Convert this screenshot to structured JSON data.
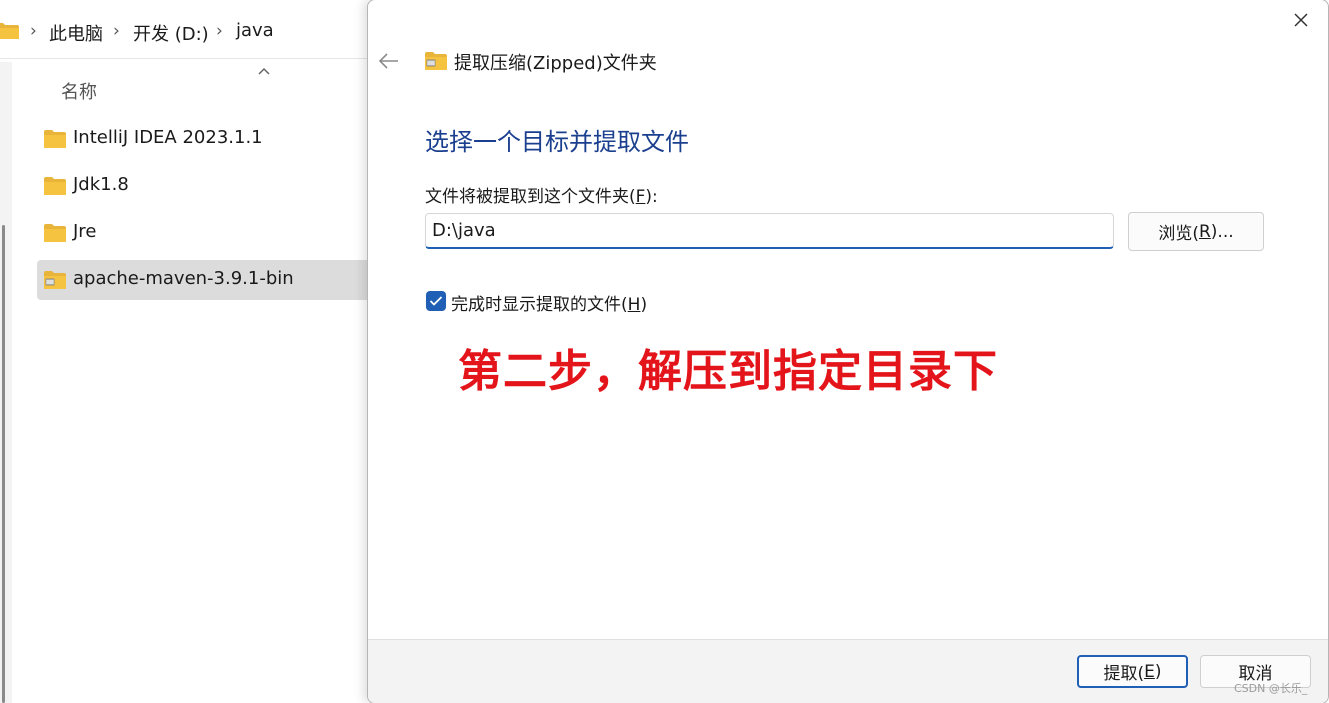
{
  "explorer": {
    "breadcrumb": [
      "此电脑",
      "开发 (D:)",
      "java"
    ],
    "column_header": "名称",
    "files": [
      {
        "name": "IntelliJ IDEA 2023.1.1",
        "type": "folder",
        "selected": false
      },
      {
        "name": "Jdk1.8",
        "type": "folder",
        "selected": false
      },
      {
        "name": "Jre",
        "type": "folder",
        "selected": false
      },
      {
        "name": "apache-maven-3.9.1-bin",
        "type": "zip-folder",
        "selected": true
      }
    ]
  },
  "dialog": {
    "title": "提取压缩(Zipped)文件夹",
    "heading": "选择一个目标并提取文件",
    "destination_label": "文件将被提取到这个文件夹(F):",
    "destination_label_prefix": "文件将被提取到这个文件夹(",
    "destination_label_key": "F",
    "destination_label_suffix": "):",
    "destination_value": "D:\\java",
    "browse_prefix": "浏览(",
    "browse_key": "R",
    "browse_suffix": ")...",
    "show_files_prefix": "完成时显示提取的文件(",
    "show_files_key": "H",
    "show_files_suffix": ")",
    "show_files_checked": true,
    "extract_prefix": "提取(",
    "extract_key": "E",
    "extract_suffix": ")",
    "cancel_label": "取消"
  },
  "annotation": "第二步，解压到指定目录下",
  "watermark": "CSDN @长乐_",
  "colors": {
    "accent": "#1f5fb5",
    "heading": "#1b3f8f",
    "annotation": "#e4141b",
    "folder": "#f6c340"
  }
}
